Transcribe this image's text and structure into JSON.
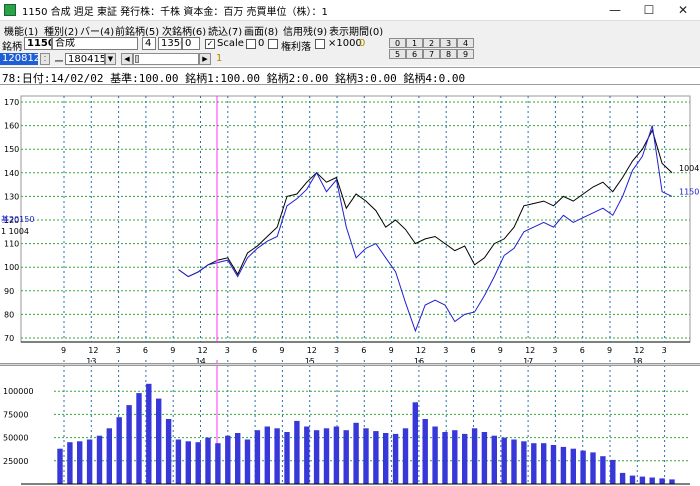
{
  "window": {
    "title": "1150 合成  週足  東証  発行株：千株  資本金：百万  売買単位（株）：1",
    "minimize": "—",
    "maximize": "☐",
    "close": "✕"
  },
  "menu": [
    "機能(1)",
    "種別(2)",
    "バー(4)",
    "前銘柄(5)",
    "次銘柄(6)",
    "読込(7)",
    "画面(8)",
    "信用残(9)",
    "表示期間(0)"
  ],
  "toolbar": {
    "code_label": "銘柄",
    "code_value": "1150",
    "name_value": "合成",
    "field_a": "4",
    "field_b": "1350",
    "field_c": "0",
    "scale_label": "Scale",
    "field_zero": "0",
    "margin_label": "権利落",
    "x1000_label": "×1000",
    "x1000_value": "0",
    "start_date": "120812",
    "dash": "ー",
    "end_date": "180415",
    "marker": "1",
    "num_buttons_row1": [
      "0",
      "1",
      "2",
      "3",
      "4"
    ],
    "num_buttons_row2": [
      "5",
      "6",
      "7",
      "8",
      "9"
    ]
  },
  "info_bar": {
    "text": "78:日付:14/02/02  基準:100.00  銘柄1:100.00  銘柄2:0.00  銘柄3:0.00  銘柄4:0.00"
  },
  "colors": {
    "series_black": "#000000",
    "series_blue": "#2020d0",
    "cursor": "#ff33ff",
    "grid_h": "#33aa33",
    "grid_v": "#2a6fb0",
    "volume_bar": "#3838d8"
  },
  "chart_data": [
    {
      "type": "line",
      "ylim": [
        70,
        170
      ],
      "y_ticks": [
        70,
        80,
        90,
        100,
        110,
        120,
        130,
        140,
        150,
        160,
        170
      ],
      "month_ticks": [
        "9",
        "12",
        "3",
        "6",
        "9",
        "12",
        "3",
        "6",
        "9",
        "12",
        "3",
        "6",
        "9",
        "12",
        "3",
        "6",
        "9",
        "12",
        "3",
        "6",
        "9",
        "12",
        "3"
      ],
      "year_labels": [
        "13",
        "14",
        "15",
        "16",
        "17",
        "18"
      ],
      "left_labels": {
        "blue": "基20150",
        "black": "1  1004"
      },
      "end_labels": {
        "black": "1004",
        "blue": "1150"
      },
      "x": [
        "2013-02",
        "2013-03",
        "2013-04",
        "2013-05",
        "2013-06",
        "2013-07",
        "2013-08",
        "2013-09",
        "2013-10",
        "2013-11",
        "2013-12",
        "2014-01",
        "2014-02",
        "2014-03",
        "2014-04",
        "2014-05",
        "2014-06",
        "2014-07",
        "2014-08",
        "2014-09",
        "2014-10",
        "2014-11",
        "2014-12",
        "2015-01",
        "2015-02",
        "2015-03",
        "2015-04",
        "2015-05",
        "2015-06",
        "2015-07",
        "2015-08",
        "2015-09",
        "2015-10",
        "2015-11",
        "2015-12",
        "2016-01",
        "2016-02",
        "2016-03",
        "2016-04",
        "2016-05",
        "2016-06",
        "2016-07",
        "2016-08",
        "2016-09",
        "2016-10",
        "2016-11",
        "2016-12",
        "2017-01",
        "2017-02",
        "2017-03",
        "2017-04",
        "2017-05",
        "2017-06",
        "2017-07",
        "2017-08",
        "2017-09",
        "2017-10",
        "2017-11",
        "2017-12",
        "2018-01",
        "2018-02",
        "2018-03",
        "2018-04"
      ],
      "series": [
        {
          "name": "1004",
          "color": "#000000",
          "values": [
            null,
            null,
            null,
            null,
            null,
            null,
            null,
            null,
            null,
            null,
            null,
            null,
            99,
            96,
            98,
            101,
            103,
            104,
            97,
            106,
            109,
            113,
            117,
            130,
            131,
            136,
            140,
            136,
            138,
            125,
            131,
            128,
            124,
            117,
            120,
            116,
            110,
            112,
            113,
            110,
            107,
            109,
            101,
            104,
            110,
            112,
            117,
            126,
            127,
            128,
            126,
            130,
            128,
            131,
            134,
            136,
            132,
            138,
            145,
            150,
            158,
            144,
            140
          ]
        },
        {
          "name": "1150",
          "color": "#2020d0",
          "values": [
            null,
            null,
            null,
            null,
            null,
            null,
            null,
            null,
            null,
            null,
            null,
            null,
            99,
            96,
            98,
            101,
            102,
            103,
            96,
            104,
            108,
            111,
            113,
            126,
            129,
            133,
            140,
            132,
            137,
            117,
            104,
            108,
            110,
            104,
            98,
            85,
            73,
            84,
            86,
            84,
            77,
            80,
            81,
            88,
            96,
            105,
            108,
            115,
            117,
            119,
            117,
            122,
            119,
            121,
            123,
            125,
            122,
            130,
            141,
            147,
            160,
            132,
            130
          ]
        }
      ]
    },
    {
      "type": "bar",
      "ylim": [
        0,
        125000
      ],
      "y_ticks": [
        25000,
        50000,
        75000,
        100000
      ],
      "x": [
        "2013-02",
        "2013-03",
        "2013-04",
        "2013-05",
        "2013-06",
        "2013-07",
        "2013-08",
        "2013-09",
        "2013-10",
        "2013-11",
        "2013-12",
        "2014-01",
        "2014-02",
        "2014-03",
        "2014-04",
        "2014-05",
        "2014-06",
        "2014-07",
        "2014-08",
        "2014-09",
        "2014-10",
        "2014-11",
        "2014-12",
        "2015-01",
        "2015-02",
        "2015-03",
        "2015-04",
        "2015-05",
        "2015-06",
        "2015-07",
        "2015-08",
        "2015-09",
        "2015-10",
        "2015-11",
        "2015-12",
        "2016-01",
        "2016-02",
        "2016-03",
        "2016-04",
        "2016-05",
        "2016-06",
        "2016-07",
        "2016-08",
        "2016-09",
        "2016-10",
        "2016-11",
        "2016-12",
        "2017-01",
        "2017-02",
        "2017-03",
        "2017-04",
        "2017-05",
        "2017-06",
        "2017-07",
        "2017-08",
        "2017-09",
        "2017-10",
        "2017-11",
        "2017-12",
        "2018-01",
        "2018-02",
        "2018-03",
        "2018-04"
      ],
      "values": [
        38000,
        45000,
        46000,
        48000,
        52000,
        60000,
        72000,
        85000,
        98000,
        108000,
        92000,
        70000,
        48000,
        46000,
        45000,
        50000,
        44000,
        52000,
        55000,
        48000,
        58000,
        62000,
        60000,
        56000,
        68000,
        62000,
        58000,
        60000,
        62000,
        58000,
        66000,
        60000,
        57000,
        55000,
        54000,
        60000,
        88000,
        70000,
        62000,
        56000,
        58000,
        54000,
        60000,
        56000,
        52000,
        50000,
        48000,
        46000,
        44000,
        44000,
        42000,
        40000,
        38000,
        36000,
        34000,
        30000,
        26000,
        12000,
        9000,
        8000,
        7000,
        6000,
        5000
      ]
    }
  ]
}
